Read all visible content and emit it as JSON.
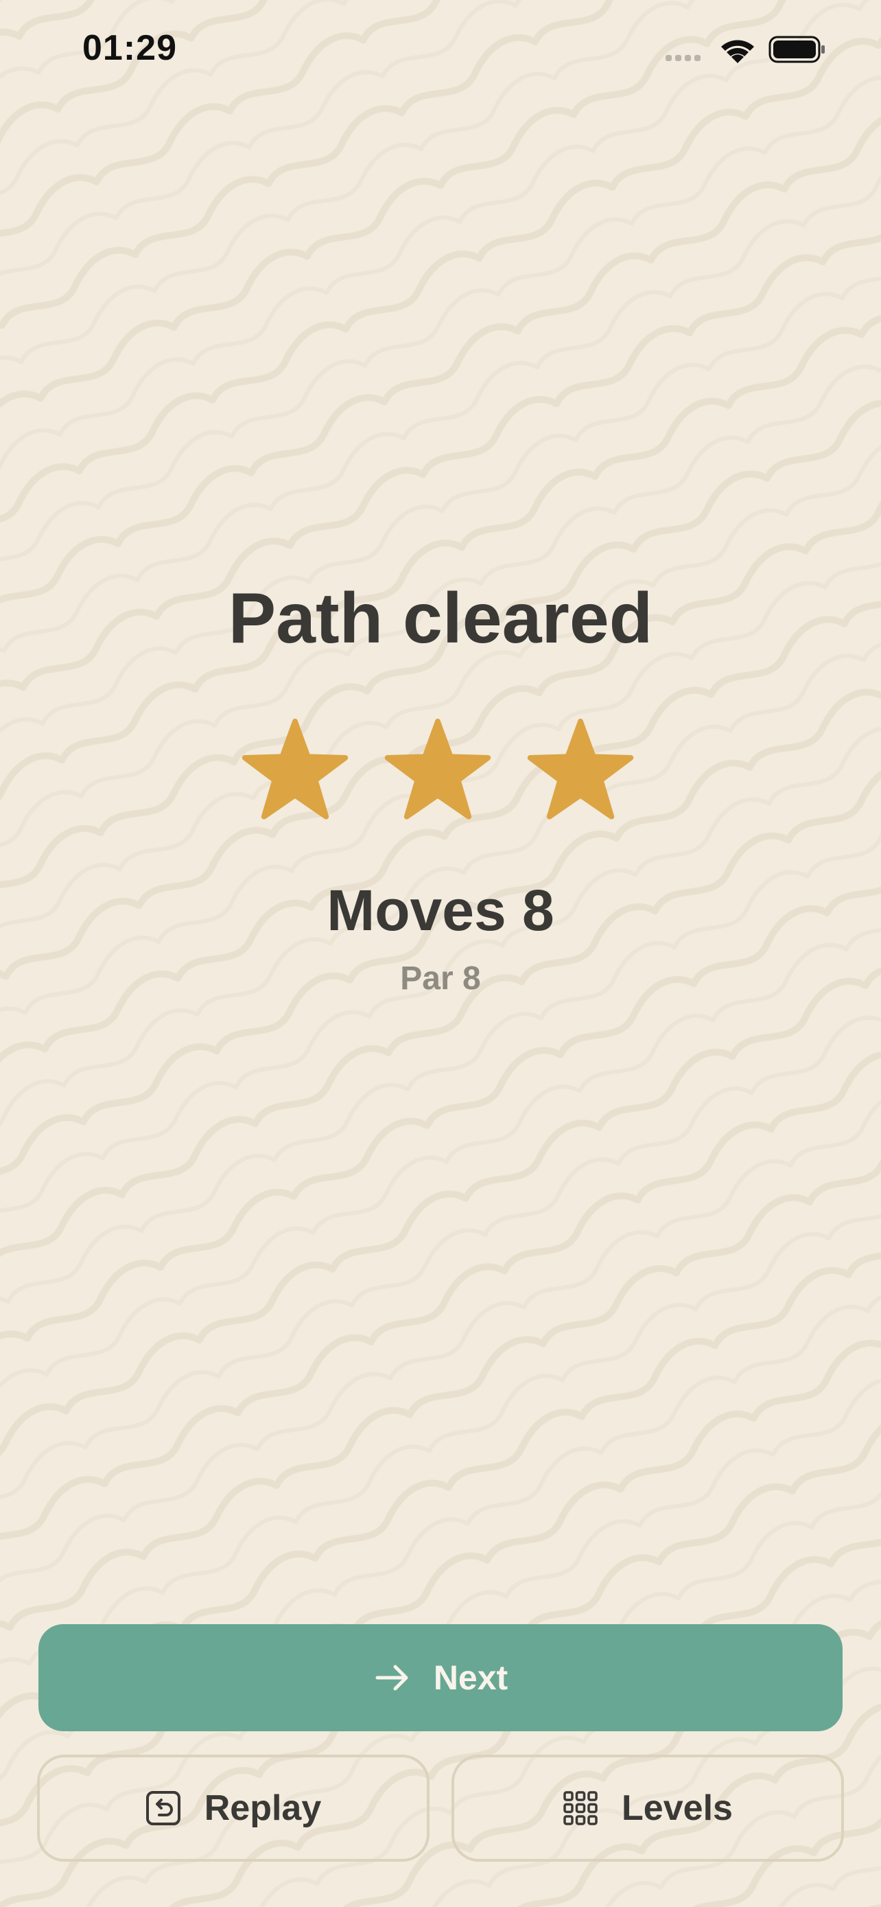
{
  "status_bar": {
    "time": "01:29",
    "icons": [
      "signal-icon",
      "wifi-icon",
      "battery-icon"
    ]
  },
  "result": {
    "title": "Path cleared",
    "stars_earned": 3,
    "stars_total": 3,
    "moves_text": "Moves 8",
    "par_text": "Par 8"
  },
  "actions": {
    "next_label": "Next",
    "replay_label": "Replay",
    "levels_label": "Levels"
  },
  "colors": {
    "background": "#f2ebde",
    "star": "#dca443",
    "primary_button": "#68a793",
    "text": "#3a3936",
    "muted_text": "#8d8a82",
    "outline": "#ddd2bd"
  }
}
